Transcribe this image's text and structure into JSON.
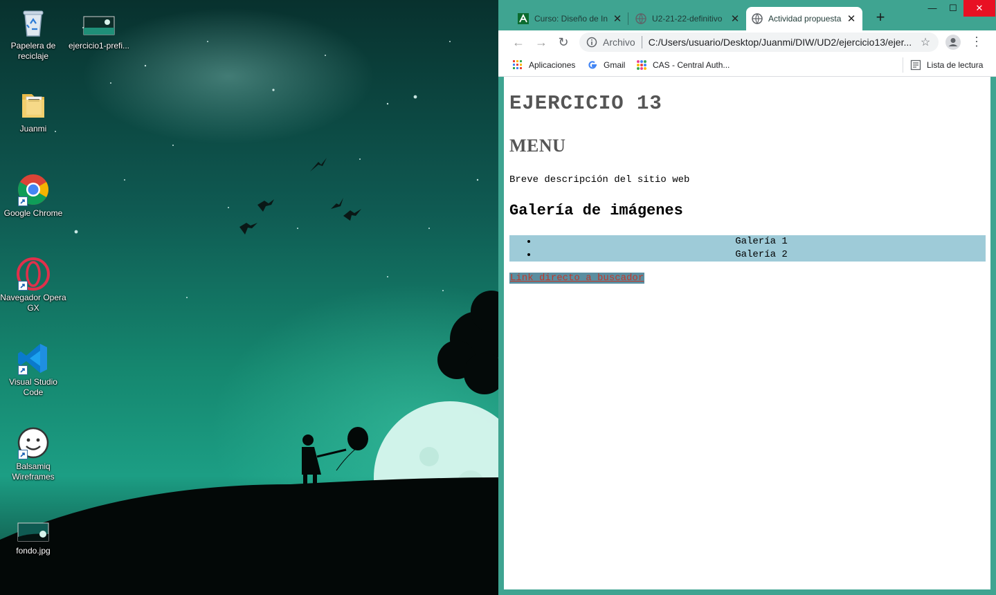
{
  "desktop": {
    "icons": [
      {
        "label": "Papelera de reciclaje",
        "icon": "recycle-bin-icon"
      },
      {
        "label": "ejercicio1-prefi...",
        "icon": "image-file-icon"
      },
      {
        "label": "Juanmi",
        "icon": "folder-icon"
      },
      {
        "label": "Google Chrome",
        "icon": "chrome-icon"
      },
      {
        "label": "Navegador Opera GX",
        "icon": "opera-gx-icon"
      },
      {
        "label": "Visual Studio Code",
        "icon": "vscode-icon"
      },
      {
        "label": "Balsamiq Wireframes",
        "icon": "balsamiq-icon"
      },
      {
        "label": "fondo.jpg",
        "icon": "image-file-icon"
      }
    ]
  },
  "browser": {
    "tabs": [
      {
        "title": "Curso: Diseño de In",
        "icon": "moodle-icon",
        "active": false
      },
      {
        "title": "U2-21-22-definitivo",
        "icon": "globe-icon",
        "active": false
      },
      {
        "title": "Actividad propuesta",
        "icon": "globe-icon",
        "active": true
      }
    ],
    "new_tab": "+",
    "window_controls": {
      "minimize": "—",
      "maximize": "☐",
      "close": "✕"
    },
    "omnibox": {
      "scheme": "Archivo",
      "url": "C:/Users/usuario/Desktop/Juanmi/DIW/UD2/ejercicio13/ejer..."
    },
    "bookmarks": [
      {
        "label": "Aplicaciones",
        "icon": "apps-grid-icon"
      },
      {
        "label": "Gmail",
        "icon": "google-icon"
      },
      {
        "label": "CAS - Central Auth...",
        "icon": "cas-icon"
      }
    ],
    "reading_list": "Lista de lectura"
  },
  "page": {
    "title": "EJERCICIO 13",
    "menu": "MENU",
    "description": "Breve descripción del sitio web",
    "gallery_heading": "Galería de imágenes",
    "gallery_items": [
      "Galería 1",
      "Galería 2"
    ],
    "link": "Link directo a buscador"
  },
  "colors": {
    "window_frame": "#3fa491",
    "gallery_bg": "#9ecbd8",
    "link_bg": "#5b8ea0",
    "link_text": "#c0392b"
  }
}
